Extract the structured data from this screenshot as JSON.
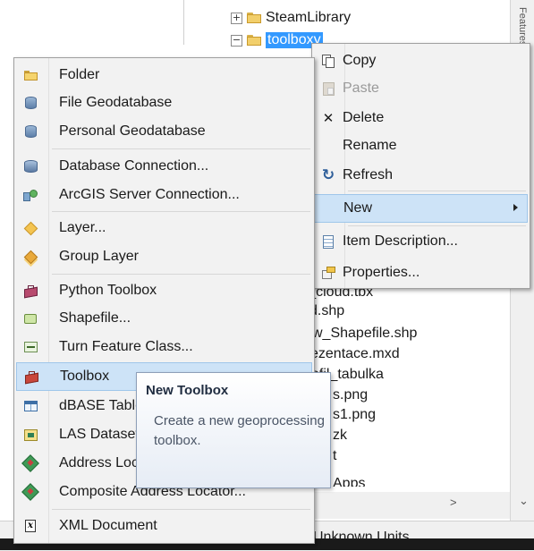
{
  "tree": {
    "items": [
      {
        "label": "SteamLibrary",
        "expander": "+"
      },
      {
        "label": "toolboxy",
        "expander": "−",
        "selected": true
      }
    ]
  },
  "background_files": [
    "rd_cloud.tbx",
    "d.shp",
    "w_Shapefile.shp",
    "ezentace.mxd",
    "ofil_tabulka",
    "s.png",
    "s1.png",
    "zk",
    "t",
    "Apps"
  ],
  "side_tab": "Features",
  "status_bar": {
    "units": "Unknown Units"
  },
  "new_submenu": {
    "items": [
      {
        "label": "Folder",
        "icon": "folder-icon"
      },
      {
        "label": "File Geodatabase",
        "icon": "file-geodatabase-icon"
      },
      {
        "label": "Personal Geodatabase",
        "icon": "personal-geodatabase-icon"
      },
      {
        "label": "Database Connection...",
        "icon": "database-connection-icon"
      },
      {
        "label": "ArcGIS Server Connection...",
        "icon": "arcgis-server-icon"
      },
      {
        "label": "Layer...",
        "icon": "layer-icon"
      },
      {
        "label": "Group Layer",
        "icon": "group-layer-icon"
      },
      {
        "label": "Python Toolbox",
        "icon": "python-toolbox-icon"
      },
      {
        "label": "Shapefile...",
        "icon": "shapefile-icon"
      },
      {
        "label": "Turn Feature Class...",
        "icon": "turn-feature-class-icon"
      },
      {
        "label": "Toolbox",
        "icon": "toolbox-icon",
        "highlighted": true
      },
      {
        "label": "dBASE Table",
        "icon": "dbase-table-icon"
      },
      {
        "label": "LAS Dataset",
        "icon": "las-dataset-icon"
      },
      {
        "label": "Address Locator...",
        "icon": "address-locator-icon"
      },
      {
        "label": "Composite Address Locator...",
        "icon": "composite-address-locator-icon"
      },
      {
        "label": "XML Document",
        "icon": "xml-document-icon"
      }
    ]
  },
  "context_menu": {
    "items": [
      {
        "label": "Copy",
        "icon": "copy-icon"
      },
      {
        "label": "Paste",
        "icon": "paste-icon",
        "disabled": true
      },
      {
        "label": "Delete",
        "icon": "delete-icon"
      },
      {
        "label": "Rename",
        "icon": ""
      },
      {
        "label": "Refresh",
        "icon": "refresh-icon"
      },
      {
        "label": "New",
        "icon": "",
        "highlighted": true,
        "has_submenu": true
      },
      {
        "label": "Item Description...",
        "icon": "item-description-icon"
      },
      {
        "label": "Properties...",
        "icon": "properties-icon"
      }
    ]
  },
  "tooltip": {
    "title": "New Toolbox",
    "body": "Create a new geoprocessing toolbox."
  },
  "icons": {
    "expand": "⊞",
    "delete": "✕",
    "refresh": "↻",
    "scroll_down": "⌄",
    "scroll_right": ">"
  },
  "colors": {
    "highlight_bg": "#cde3f7",
    "highlight_border": "#9fc6ea",
    "selection": "#3399ff",
    "menu_bg": "#f2f2f2"
  }
}
